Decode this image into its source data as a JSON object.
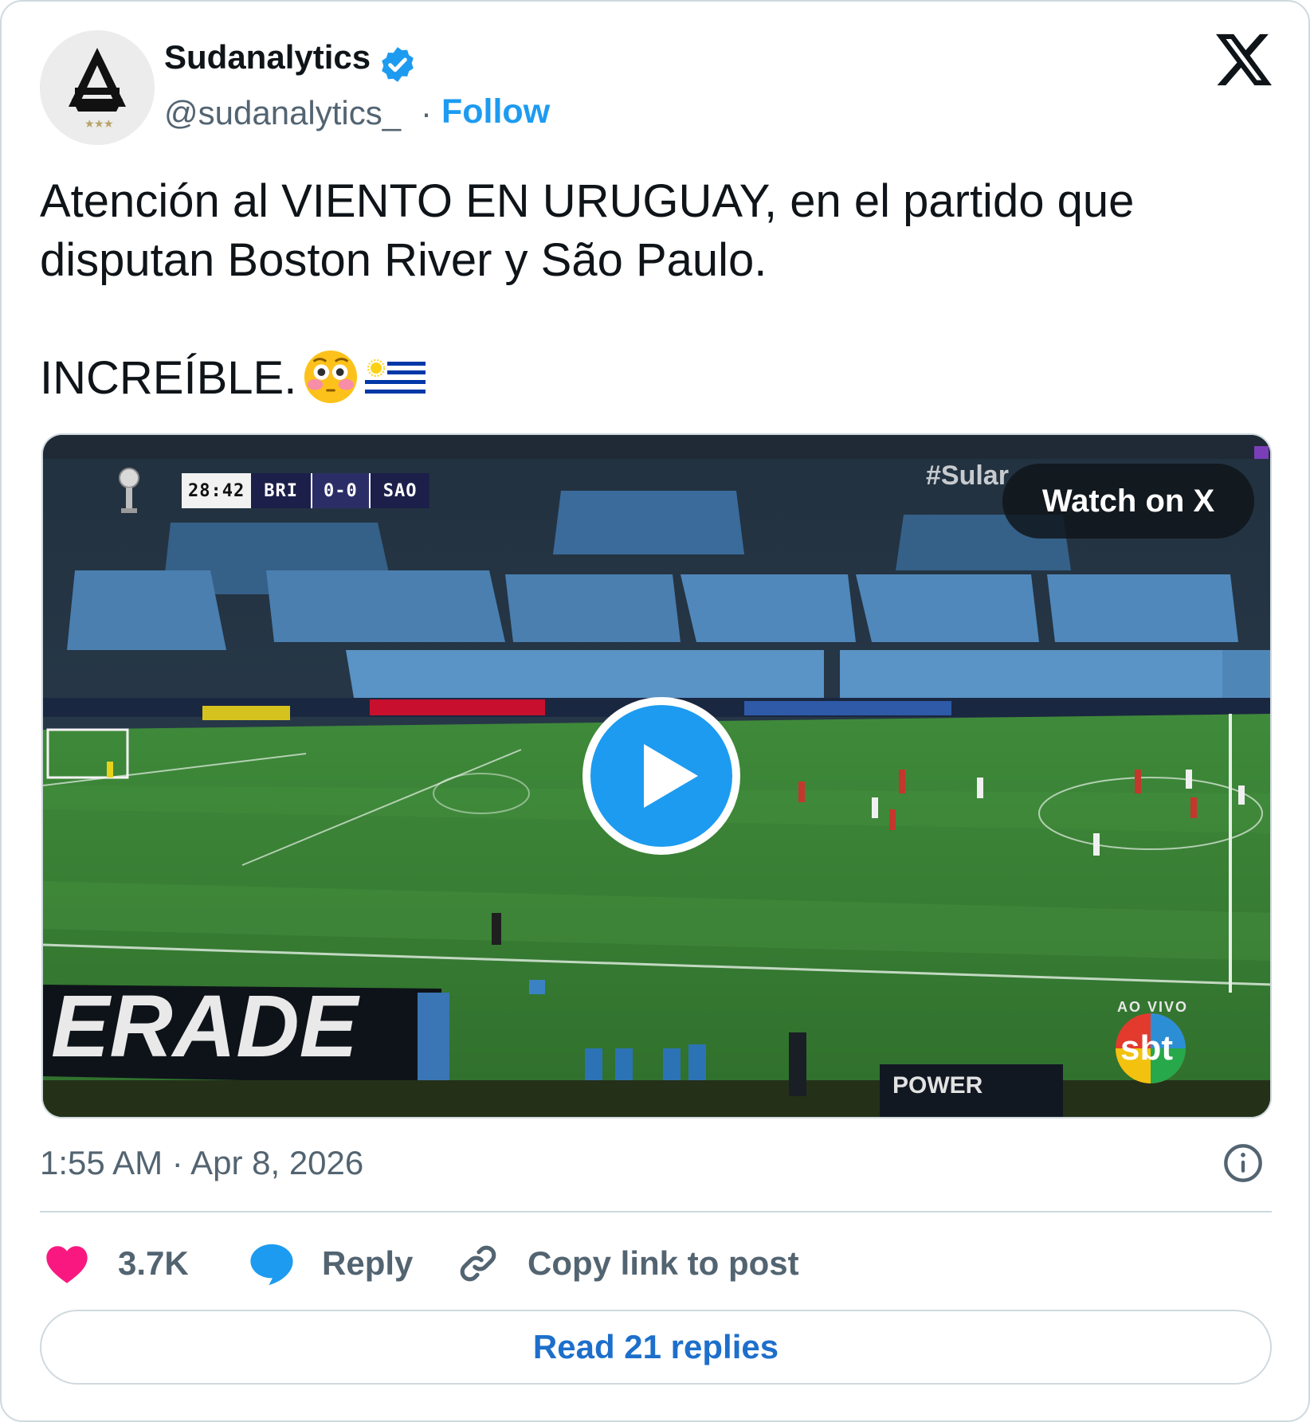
{
  "author": {
    "name": "Sudanalytics",
    "handle": "@sudanalytics_",
    "separator": "·",
    "follow_label": "Follow",
    "verified": true
  },
  "tweet": {
    "line1": "Atención al VIENTO EN URUGUAY, en el partido que",
    "line2": "disputan Boston River y São Paulo.",
    "line3": "INCREÍBLE.",
    "emojis": [
      "flushed-face",
      "uruguay-flag"
    ]
  },
  "video": {
    "watch_label": "Watch on X",
    "hashtag": "#Sular",
    "scorebug": {
      "clock": "28:42",
      "home": "BRI",
      "score": "0-0",
      "away": "SAO"
    },
    "ao_vivo": "AO VIVO",
    "broadcaster": "sbt",
    "board_text": "ERADE",
    "power_text": "POWER"
  },
  "meta": {
    "timestamp": "1:55 AM · Apr 8, 2026"
  },
  "actions": {
    "likes": "3.7K",
    "reply_label": "Reply",
    "copy_label": "Copy link to post"
  },
  "read_replies_label": "Read 21 replies",
  "colors": {
    "accent": "#1d9bf0",
    "like": "#f91880",
    "text": "#0f1419",
    "muted": "#536471",
    "border": "#cfd9de"
  }
}
